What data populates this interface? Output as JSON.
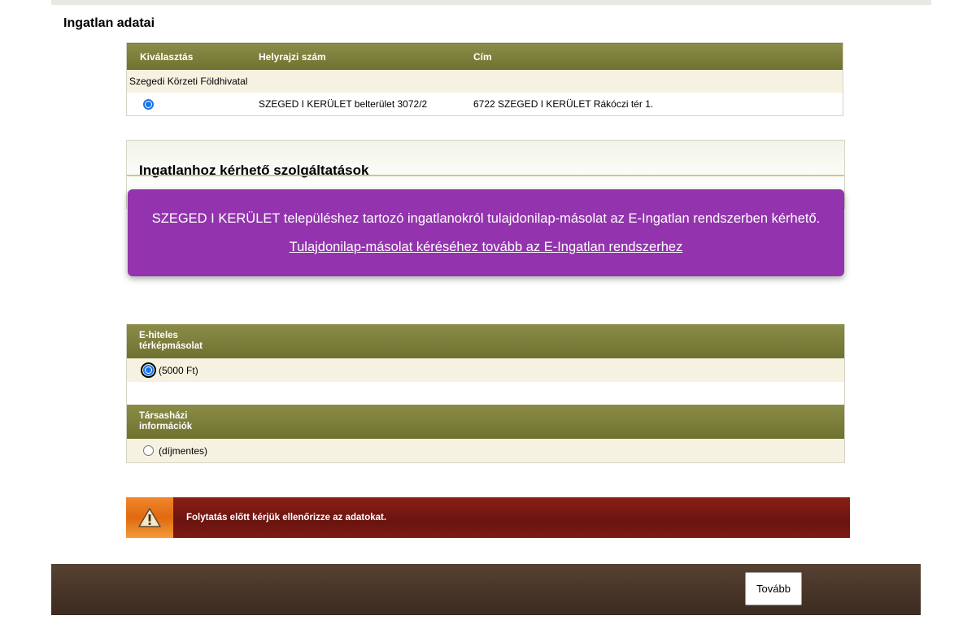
{
  "page": {
    "heading": "Ingatlan adatai"
  },
  "property_table": {
    "headers": [
      "Kiválasztás",
      "Helyrajzi szám",
      "Cím"
    ],
    "office": "Szegedi Körzeti Földhivatal",
    "row": {
      "selected": true,
      "parcel": "SZEGED I KERÜLET belterület 3072/2",
      "address": "6722 SZEGED I KERÜLET Rákóczi tér 1."
    }
  },
  "services": {
    "title": "Ingatlanhoz kérhető szolgáltatások"
  },
  "notice": {
    "text": "SZEGED I KERÜLET településhez tartozó ingatlanokról tulajdonilap-másolat az E-Ingatlan rendszerben kérhető.",
    "link": "Tulajdonilap-másolat kéréséhez tovább az E-Ingatlan rendszerhez",
    "background": "#9333ae"
  },
  "options": [
    {
      "heading_line1": "E-hiteles",
      "heading_line2": "térképmásolat",
      "label": "(5000 Ft)",
      "selected": true
    },
    {
      "heading_line1": "Társasházi",
      "heading_line2": "információk",
      "label": "(díjmentes)",
      "selected": false
    }
  ],
  "warning": {
    "text": "Folytatás előtt kérjük ellenőrizze az adatokat.",
    "icon": "warning-triangle-icon"
  },
  "footer": {
    "next_label": "Tovább"
  }
}
